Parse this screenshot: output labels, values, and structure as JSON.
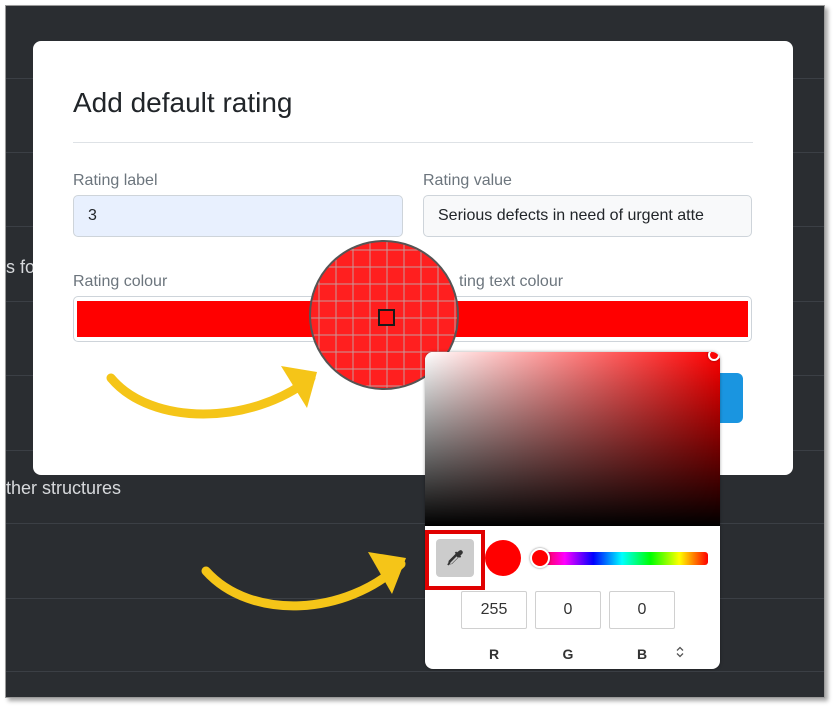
{
  "background": {
    "text_fragment_1": "s fo",
    "text_fragment_2": "ther structures"
  },
  "modal": {
    "title": "Add default rating",
    "rating_label": {
      "label": "Rating label",
      "value": "3"
    },
    "rating_value": {
      "label": "Rating value",
      "value": "Serious defects in need of urgent atte"
    },
    "rating_colour": {
      "label": "Rating colour",
      "color": "#ff0000"
    },
    "rating_text_colour": {
      "label": "ting text colour",
      "color": "#ff0000"
    }
  },
  "picker": {
    "r": "255",
    "g": "0",
    "b": "0",
    "labels": {
      "r": "R",
      "g": "G",
      "b": "B"
    },
    "selected_color": "#ff0000",
    "mode_toggle_icon": "up-down-chevron-icon"
  },
  "annotations": {
    "arrow_color": "#f5c518",
    "highlight_color": "#e00000"
  },
  "icons": {
    "eyedropper": "eyedropper-icon",
    "magnifier": "magnifier-loupe"
  }
}
